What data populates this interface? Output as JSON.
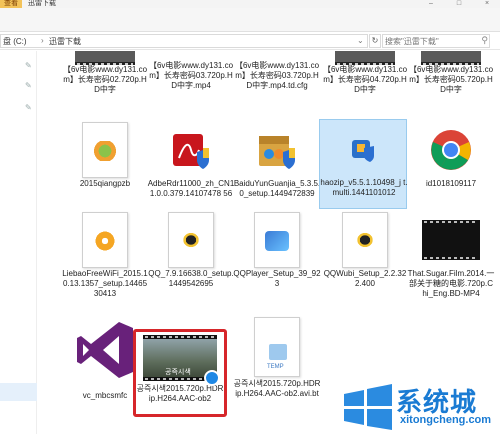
{
  "window": {
    "title_tab": "查看",
    "title": "迅雷下载"
  },
  "address": {
    "drive": "盘 (C:)",
    "folder": "迅雷下载",
    "search_placeholder": "搜索\"迅雷下载\""
  },
  "items": [
    {
      "name": "【6v电影www.dy131.com】长寿密码02.720p.HD中字",
      "kind": "video-partial"
    },
    {
      "name": "【6v电影www.dy131.com】长寿密码03.720p.HD中字.mp4",
      "kind": "doc-partial"
    },
    {
      "name": "【6v电影www.dy131.com】长寿密码03.720p.HD中字.mp4.td.cfg",
      "kind": "doc-partial"
    },
    {
      "name": "【6v电影www.dy131.com】长寿密码04.720p.HD中字",
      "kind": "video-partial"
    },
    {
      "name": "【6v电影www.dy131.com】长寿密码05.720p.HD中字",
      "kind": "video-partial"
    },
    {
      "name": "2015qiangpzb",
      "kind": "app"
    },
    {
      "name": "AdbeRdr11000_zh_CN11.0.0.379.14107478 56",
      "kind": "installer"
    },
    {
      "name": "BaiduYunGuanjia_5.3.5.0_setup.1449472839",
      "kind": "installer"
    },
    {
      "name": "haozip_v5.5.1.10498_j t.multi.1441101012",
      "kind": "installer"
    },
    {
      "name": "id1018109117",
      "kind": "chrome"
    },
    {
      "name": "LiebaoFreeWiFi_2015.10.13.1357_setup.1446530413",
      "kind": "app"
    },
    {
      "name": "QQ_7.9.16638.0_setup.1449542695",
      "kind": "app"
    },
    {
      "name": "QQPlayer_Setup_39_923",
      "kind": "app"
    },
    {
      "name": "QQWubi_Setup_2.2.322.400",
      "kind": "app"
    },
    {
      "name": "That.Sugar.Film.2014.一部关于糖的电影.720p.Chi_Eng.BD-MP4",
      "kind": "video"
    },
    {
      "name": "vc_mbcsmfc",
      "kind": "vs"
    },
    {
      "name": "공즉시색2015.720p.HDRip.H264.AAC-ob2",
      "kind": "video"
    },
    {
      "name": "공즉시색2015.720p.HDRip.H264.AAC-ob2.avi.bt",
      "kind": "temp"
    }
  ],
  "thumb_texts": {
    "korean_title": "공즉시색",
    "temp_label": "TEMP"
  },
  "watermark": {
    "brand": "系统城",
    "url": "xitongcheng.com"
  },
  "colors": {
    "selection": "#cce6fa",
    "highlight_box": "#d6262a",
    "watermark": "#1a7bd3"
  }
}
